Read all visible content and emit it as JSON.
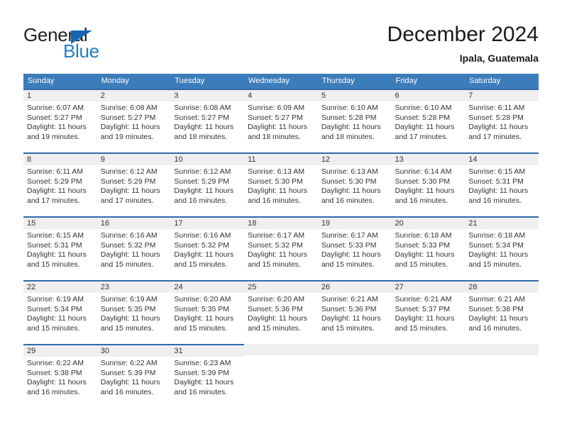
{
  "logo": {
    "word_top": "General",
    "word_bottom": "Blue",
    "triangle_color": "#1567b3",
    "blue_color": "#1f7ec4"
  },
  "header": {
    "title": "December 2024",
    "subtitle": "Ipala, Guatemala"
  },
  "theme": {
    "header_blue": "#3c7cba",
    "cell_border_blue": "#2f6ba8",
    "day_num_band": "#efefef"
  },
  "calendar": {
    "day_names": [
      "Sunday",
      "Monday",
      "Tuesday",
      "Wednesday",
      "Thursday",
      "Friday",
      "Saturday"
    ],
    "weeks": [
      [
        {
          "day": "1",
          "sunrise": "Sunrise: 6:07 AM",
          "sunset": "Sunset: 5:27 PM",
          "daylight1": "Daylight: 11 hours",
          "daylight2": "and 19 minutes."
        },
        {
          "day": "2",
          "sunrise": "Sunrise: 6:08 AM",
          "sunset": "Sunset: 5:27 PM",
          "daylight1": "Daylight: 11 hours",
          "daylight2": "and 19 minutes."
        },
        {
          "day": "3",
          "sunrise": "Sunrise: 6:08 AM",
          "sunset": "Sunset: 5:27 PM",
          "daylight1": "Daylight: 11 hours",
          "daylight2": "and 18 minutes."
        },
        {
          "day": "4",
          "sunrise": "Sunrise: 6:09 AM",
          "sunset": "Sunset: 5:27 PM",
          "daylight1": "Daylight: 11 hours",
          "daylight2": "and 18 minutes."
        },
        {
          "day": "5",
          "sunrise": "Sunrise: 6:10 AM",
          "sunset": "Sunset: 5:28 PM",
          "daylight1": "Daylight: 11 hours",
          "daylight2": "and 18 minutes."
        },
        {
          "day": "6",
          "sunrise": "Sunrise: 6:10 AM",
          "sunset": "Sunset: 5:28 PM",
          "daylight1": "Daylight: 11 hours",
          "daylight2": "and 17 minutes."
        },
        {
          "day": "7",
          "sunrise": "Sunrise: 6:11 AM",
          "sunset": "Sunset: 5:28 PM",
          "daylight1": "Daylight: 11 hours",
          "daylight2": "and 17 minutes."
        }
      ],
      [
        {
          "day": "8",
          "sunrise": "Sunrise: 6:11 AM",
          "sunset": "Sunset: 5:29 PM",
          "daylight1": "Daylight: 11 hours",
          "daylight2": "and 17 minutes."
        },
        {
          "day": "9",
          "sunrise": "Sunrise: 6:12 AM",
          "sunset": "Sunset: 5:29 PM",
          "daylight1": "Daylight: 11 hours",
          "daylight2": "and 17 minutes."
        },
        {
          "day": "10",
          "sunrise": "Sunrise: 6:12 AM",
          "sunset": "Sunset: 5:29 PM",
          "daylight1": "Daylight: 11 hours",
          "daylight2": "and 16 minutes."
        },
        {
          "day": "11",
          "sunrise": "Sunrise: 6:13 AM",
          "sunset": "Sunset: 5:30 PM",
          "daylight1": "Daylight: 11 hours",
          "daylight2": "and 16 minutes."
        },
        {
          "day": "12",
          "sunrise": "Sunrise: 6:13 AM",
          "sunset": "Sunset: 5:30 PM",
          "daylight1": "Daylight: 11 hours",
          "daylight2": "and 16 minutes."
        },
        {
          "day": "13",
          "sunrise": "Sunrise: 6:14 AM",
          "sunset": "Sunset: 5:30 PM",
          "daylight1": "Daylight: 11 hours",
          "daylight2": "and 16 minutes."
        },
        {
          "day": "14",
          "sunrise": "Sunrise: 6:15 AM",
          "sunset": "Sunset: 5:31 PM",
          "daylight1": "Daylight: 11 hours",
          "daylight2": "and 16 minutes."
        }
      ],
      [
        {
          "day": "15",
          "sunrise": "Sunrise: 6:15 AM",
          "sunset": "Sunset: 5:31 PM",
          "daylight1": "Daylight: 11 hours",
          "daylight2": "and 15 minutes."
        },
        {
          "day": "16",
          "sunrise": "Sunrise: 6:16 AM",
          "sunset": "Sunset: 5:32 PM",
          "daylight1": "Daylight: 11 hours",
          "daylight2": "and 15 minutes."
        },
        {
          "day": "17",
          "sunrise": "Sunrise: 6:16 AM",
          "sunset": "Sunset: 5:32 PM",
          "daylight1": "Daylight: 11 hours",
          "daylight2": "and 15 minutes."
        },
        {
          "day": "18",
          "sunrise": "Sunrise: 6:17 AM",
          "sunset": "Sunset: 5:32 PM",
          "daylight1": "Daylight: 11 hours",
          "daylight2": "and 15 minutes."
        },
        {
          "day": "19",
          "sunrise": "Sunrise: 6:17 AM",
          "sunset": "Sunset: 5:33 PM",
          "daylight1": "Daylight: 11 hours",
          "daylight2": "and 15 minutes."
        },
        {
          "day": "20",
          "sunrise": "Sunrise: 6:18 AM",
          "sunset": "Sunset: 5:33 PM",
          "daylight1": "Daylight: 11 hours",
          "daylight2": "and 15 minutes."
        },
        {
          "day": "21",
          "sunrise": "Sunrise: 6:18 AM",
          "sunset": "Sunset: 5:34 PM",
          "daylight1": "Daylight: 11 hours",
          "daylight2": "and 15 minutes."
        }
      ],
      [
        {
          "day": "22",
          "sunrise": "Sunrise: 6:19 AM",
          "sunset": "Sunset: 5:34 PM",
          "daylight1": "Daylight: 11 hours",
          "daylight2": "and 15 minutes."
        },
        {
          "day": "23",
          "sunrise": "Sunrise: 6:19 AM",
          "sunset": "Sunset: 5:35 PM",
          "daylight1": "Daylight: 11 hours",
          "daylight2": "and 15 minutes."
        },
        {
          "day": "24",
          "sunrise": "Sunrise: 6:20 AM",
          "sunset": "Sunset: 5:35 PM",
          "daylight1": "Daylight: 11 hours",
          "daylight2": "and 15 minutes."
        },
        {
          "day": "25",
          "sunrise": "Sunrise: 6:20 AM",
          "sunset": "Sunset: 5:36 PM",
          "daylight1": "Daylight: 11 hours",
          "daylight2": "and 15 minutes."
        },
        {
          "day": "26",
          "sunrise": "Sunrise: 6:21 AM",
          "sunset": "Sunset: 5:36 PM",
          "daylight1": "Daylight: 11 hours",
          "daylight2": "and 15 minutes."
        },
        {
          "day": "27",
          "sunrise": "Sunrise: 6:21 AM",
          "sunset": "Sunset: 5:37 PM",
          "daylight1": "Daylight: 11 hours",
          "daylight2": "and 15 minutes."
        },
        {
          "day": "28",
          "sunrise": "Sunrise: 6:21 AM",
          "sunset": "Sunset: 5:38 PM",
          "daylight1": "Daylight: 11 hours",
          "daylight2": "and 16 minutes."
        }
      ],
      [
        {
          "day": "29",
          "sunrise": "Sunrise: 6:22 AM",
          "sunset": "Sunset: 5:38 PM",
          "daylight1": "Daylight: 11 hours",
          "daylight2": "and 16 minutes."
        },
        {
          "day": "30",
          "sunrise": "Sunrise: 6:22 AM",
          "sunset": "Sunset: 5:39 PM",
          "daylight1": "Daylight: 11 hours",
          "daylight2": "and 16 minutes."
        },
        {
          "day": "31",
          "sunrise": "Sunrise: 6:23 AM",
          "sunset": "Sunset: 5:39 PM",
          "daylight1": "Daylight: 11 hours",
          "daylight2": "and 16 minutes."
        },
        {
          "day": "",
          "sunrise": "",
          "sunset": "",
          "daylight1": "",
          "daylight2": ""
        },
        {
          "day": "",
          "sunrise": "",
          "sunset": "",
          "daylight1": "",
          "daylight2": ""
        },
        {
          "day": "",
          "sunrise": "",
          "sunset": "",
          "daylight1": "",
          "daylight2": ""
        },
        {
          "day": "",
          "sunrise": "",
          "sunset": "",
          "daylight1": "",
          "daylight2": ""
        }
      ]
    ]
  }
}
